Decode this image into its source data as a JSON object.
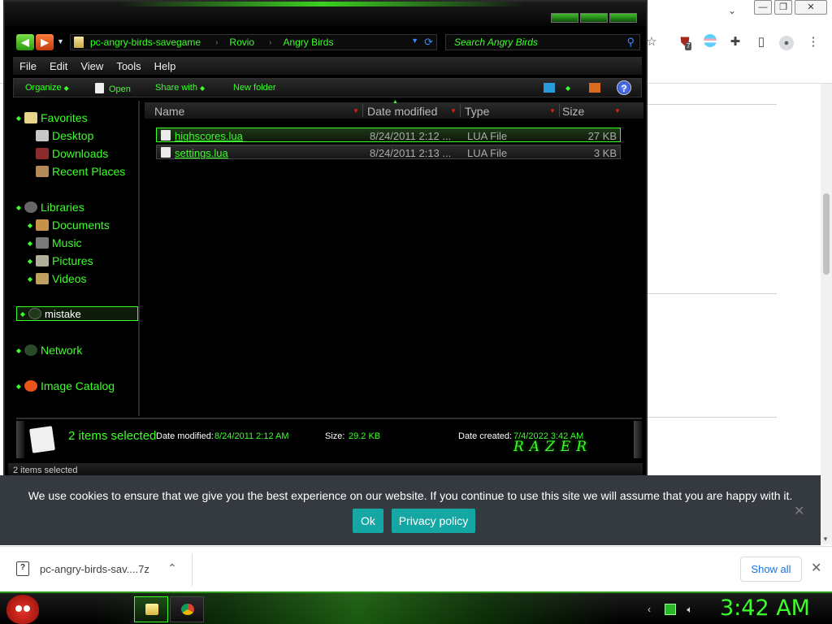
{
  "browser": {
    "window_controls": {
      "minimize": "—",
      "restore": "❐",
      "close": "✕"
    },
    "extension_icons": [
      "star-icon",
      "ublock-icon",
      "shield-flag-icon",
      "puzzle-icon",
      "sidepanel-icon",
      "profile-icon",
      "kebab-icon"
    ],
    "extension_badge": "7"
  },
  "explorer": {
    "breadcrumb": [
      "pc-angry-birds-savegame",
      "Rovio",
      "Angry Birds"
    ],
    "search_placeholder": "Search Angry Birds",
    "menu": [
      "File",
      "Edit",
      "View",
      "Tools",
      "Help"
    ],
    "commands": {
      "organize": "Organize",
      "open": "Open",
      "share_with": "Share with",
      "new_folder": "New folder",
      "help": "?"
    },
    "nav": {
      "favorites": "Favorites",
      "favorites_items": [
        "Desktop",
        "Downloads",
        "Recent Places"
      ],
      "libraries": "Libraries",
      "libraries_items": [
        "Documents",
        "Music",
        "Pictures",
        "Videos"
      ],
      "selected": "mistake",
      "network": "Network",
      "image_catalog": "Image Catalog"
    },
    "columns": {
      "name": "Name",
      "date_modified": "Date modified",
      "type": "Type",
      "size": "Size"
    },
    "files": [
      {
        "name": "highscores.lua",
        "date": "8/24/2011 2:12 ...",
        "type": "LUA File",
        "size": "27 KB"
      },
      {
        "name": "settings.lua",
        "date": "8/24/2011 2:13 ...",
        "type": "LUA File",
        "size": "3 KB"
      }
    ],
    "details": {
      "selection_count": "2 items selected",
      "date_modified_label": "Date modified:",
      "date_modified_value": "8/24/2011 2:12 AM",
      "size_label": "Size:",
      "size_value": "29.2 KB",
      "date_created_label": "Date created:",
      "date_created_value": "7/4/2022 3:42 AM",
      "brand": "RAZER"
    },
    "status": "2 items selected"
  },
  "cookie": {
    "message": "We use cookies to ensure that we give you the best experience on our website. If you continue to use this site we will assume that you are happy with it.",
    "ok": "Ok",
    "privacy": "Privacy policy",
    "close": "✕"
  },
  "downloads": {
    "file": "pc-angry-birds-sav....7z",
    "file_icon": "?",
    "show_all": "Show all",
    "close": "✕"
  },
  "taskbar": {
    "clock": "3:42 AM",
    "pinned": [
      "explorer-icon",
      "chrome-icon"
    ]
  },
  "colors": {
    "accent": "#3cff2a",
    "cookie_bg": "#353a40",
    "cookie_btn": "#15a7a3",
    "link_blue": "#1a73e8"
  }
}
